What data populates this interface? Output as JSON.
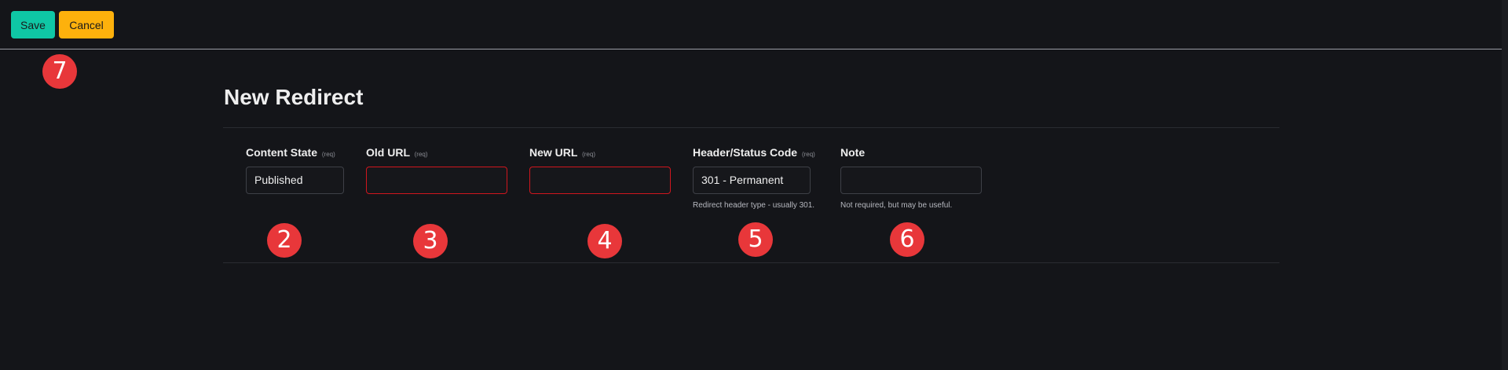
{
  "toolbar": {
    "save_label": "Save",
    "cancel_label": "Cancel"
  },
  "page_title": "New Redirect",
  "form": {
    "content_state": {
      "label": "Content State",
      "req": "(req)",
      "value": "Published"
    },
    "old_url": {
      "label": "Old URL",
      "req": "(req)",
      "value": ""
    },
    "new_url": {
      "label": "New URL",
      "req": "(req)",
      "value": ""
    },
    "status_code": {
      "label": "Header/Status Code",
      "req": "(req)",
      "value": "301 - Permanent",
      "help": "Redirect header type - usually 301."
    },
    "note": {
      "label": "Note",
      "value": "",
      "help": "Not required, but may be useful."
    }
  },
  "annotations": {
    "a2": "2",
    "a3": "3",
    "a4": "4",
    "a5": "5",
    "a6": "6",
    "a7": "7"
  },
  "colors": {
    "background": "#141519",
    "save": "#0fc7a5",
    "cancel": "#fdb10c",
    "invalid_border": "#d0161e",
    "annotation": "#e8373a"
  }
}
